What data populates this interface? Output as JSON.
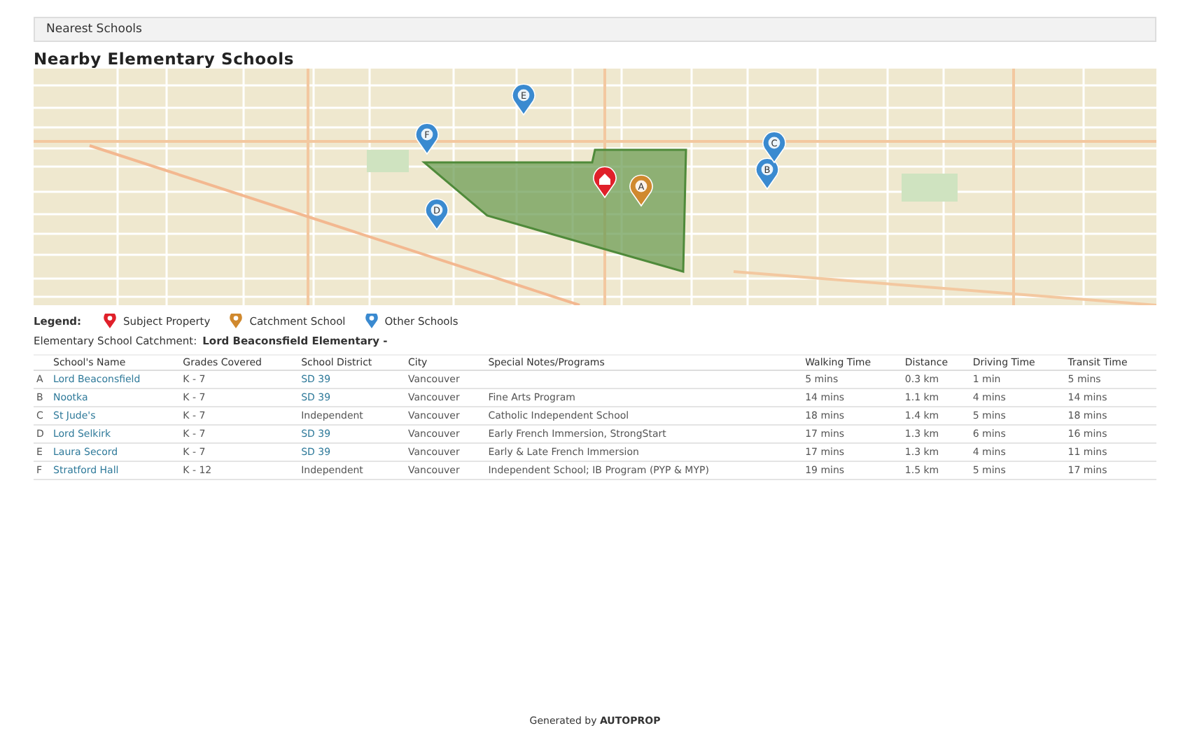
{
  "section_header": "Nearest Schools",
  "title": "Nearby Elementary Schools",
  "map": {
    "markers": [
      {
        "kind": "subject"
      },
      {
        "kind": "catchment",
        "label": "A"
      },
      {
        "kind": "other",
        "label": "B"
      },
      {
        "kind": "other",
        "label": "C"
      },
      {
        "kind": "other",
        "label": "D"
      },
      {
        "kind": "other",
        "label": "E"
      },
      {
        "kind": "other",
        "label": "F"
      }
    ]
  },
  "legend": {
    "label": "Legend:",
    "items": [
      {
        "kind": "subject",
        "label": "Subject Property"
      },
      {
        "kind": "catchment",
        "label": "Catchment School"
      },
      {
        "kind": "other",
        "label": "Other Schools"
      }
    ]
  },
  "catchment": {
    "label": "Elementary School Catchment:",
    "value": "Lord Beaconsfield Elementary -"
  },
  "table": {
    "columns": [
      "School's Name",
      "Grades Covered",
      "School District",
      "City",
      "Special Notes/Programs",
      "Walking Time",
      "Distance",
      "Driving Time",
      "Transit Time"
    ],
    "rows": [
      {
        "letter": "A",
        "name": "Lord Beaconsfield",
        "grades": "K - 7",
        "district": "SD 39",
        "district_link": true,
        "city": "Vancouver",
        "notes": "",
        "walking": "5 mins",
        "distance": "0.3 km",
        "driving": "1 min",
        "transit": "5 mins"
      },
      {
        "letter": "B",
        "name": "Nootka",
        "grades": "K - 7",
        "district": "SD 39",
        "district_link": true,
        "city": "Vancouver",
        "notes": "Fine Arts Program",
        "walking": "14 mins",
        "distance": "1.1 km",
        "driving": "4 mins",
        "transit": "14 mins"
      },
      {
        "letter": "C",
        "name": "St Jude's",
        "grades": "K - 7",
        "district": "Independent",
        "district_link": false,
        "city": "Vancouver",
        "notes": "Catholic Independent School",
        "walking": "18 mins",
        "distance": "1.4 km",
        "driving": "5 mins",
        "transit": "18 mins"
      },
      {
        "letter": "D",
        "name": "Lord Selkirk",
        "grades": "K - 7",
        "district": "SD 39",
        "district_link": true,
        "city": "Vancouver",
        "notes": "Early French Immersion, StrongStart",
        "walking": "17 mins",
        "distance": "1.3 km",
        "driving": "6 mins",
        "transit": "16 mins"
      },
      {
        "letter": "E",
        "name": "Laura Secord",
        "grades": "K - 7",
        "district": "SD 39",
        "district_link": true,
        "city": "Vancouver",
        "notes": "Early & Late French Immersion",
        "walking": "17 mins",
        "distance": "1.3 km",
        "driving": "4 mins",
        "transit": "11 mins"
      },
      {
        "letter": "F",
        "name": "Stratford Hall",
        "grades": "K - 12",
        "district": "Independent",
        "district_link": false,
        "city": "Vancouver",
        "notes": "Independent School; IB Program (PYP & MYP)",
        "walking": "19 mins",
        "distance": "1.5 km",
        "driving": "5 mins",
        "transit": "17 mins"
      }
    ]
  },
  "footer": {
    "prefix": "Generated by",
    "brand": "AUTOPROP"
  }
}
